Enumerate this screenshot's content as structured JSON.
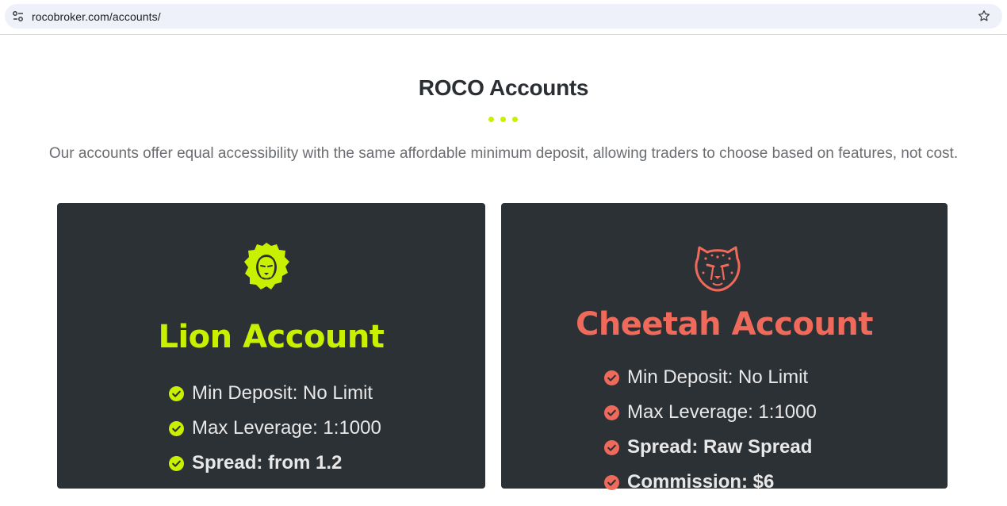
{
  "browser": {
    "url": "rocobroker.com/accounts/",
    "site_settings_icon": "tune-icon",
    "bookmark_icon": "star-icon"
  },
  "header": {
    "title": "ROCO Accounts",
    "subtitle": "Our accounts offer equal accessibility with the same affordable minimum deposit, allowing traders to choose based on features, not cost.",
    "accent_color": "#c8f000"
  },
  "accounts": [
    {
      "name": "Lion Account",
      "icon": "lion-head-icon",
      "color": "#c8f000",
      "features": [
        "Min Deposit: No Limit",
        "Max Leverage: 1:1000",
        "Spread: from 1.2"
      ]
    },
    {
      "name": "Cheetah Account",
      "icon": "cheetah-head-icon",
      "color": "#f06a5b",
      "features": [
        "Min Deposit: No Limit",
        "Max Leverage: 1:1000",
        "Spread: Raw Spread",
        "Commission: $6"
      ]
    }
  ],
  "card_background": "#2c3135"
}
